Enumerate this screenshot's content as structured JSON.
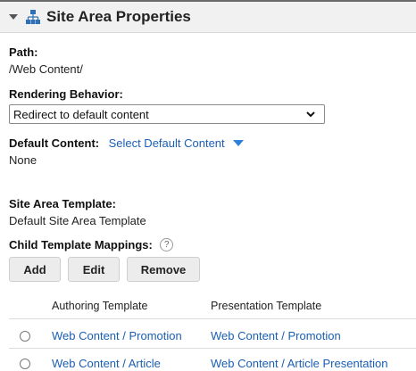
{
  "header": {
    "title": "Site Area Properties"
  },
  "path": {
    "label": "Path:",
    "value": "/Web Content/"
  },
  "rendering": {
    "label": "Rendering Behavior:",
    "selected": "Redirect to default content"
  },
  "default_content": {
    "label": "Default Content:",
    "link": "Select Default Content",
    "value": "None"
  },
  "site_area_template": {
    "label": "Site Area Template:",
    "value": "Default Site Area Template"
  },
  "child_mappings": {
    "label": "Child Template Mappings:",
    "help": "?",
    "buttons": {
      "add": "Add",
      "edit": "Edit",
      "remove": "Remove"
    },
    "columns": [
      "Authoring Template",
      "Presentation Template"
    ],
    "rows": [
      {
        "authoring": "Web Content / Promotion",
        "presentation": "Web Content / Promotion"
      },
      {
        "authoring": "Web Content / Article",
        "presentation": "Web Content / Article Presentation"
      }
    ]
  },
  "colors": {
    "link": "#1a5fb4",
    "caret": "#2f7fd8",
    "header_bg": "#f1f1f1"
  }
}
